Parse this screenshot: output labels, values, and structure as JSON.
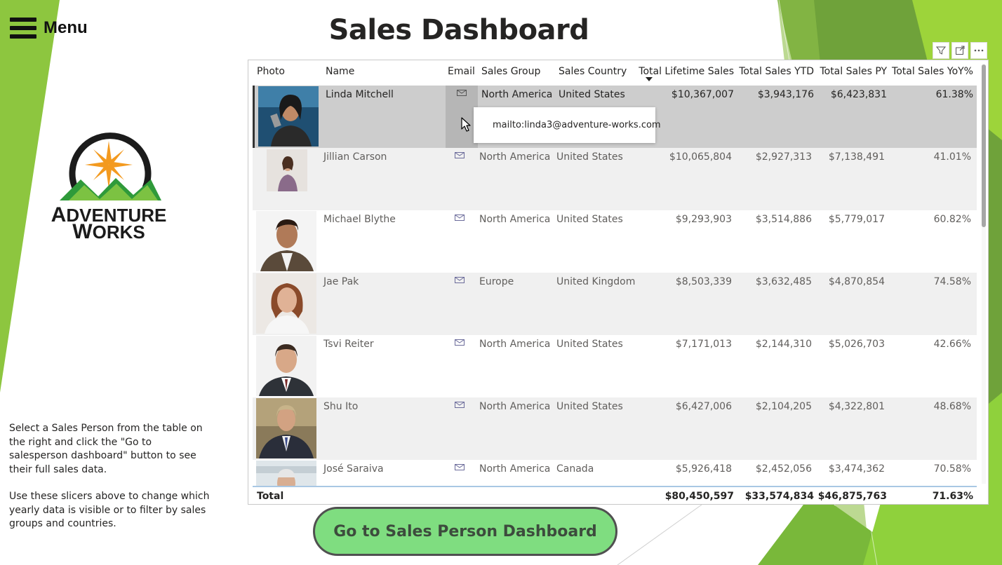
{
  "header": {
    "menu_label": "Menu",
    "title": "Sales Dashboard"
  },
  "logo": {
    "line1_first": "A",
    "line1_rest": "DVENTURE",
    "line2_first": "W",
    "line2_rest": "ORKS"
  },
  "instructions": {
    "paragraph1": "Select a Sales Person from the table on the right and click the \"Go to salesperson dashboard\" button to see their full sales data.",
    "paragraph2": "Use these slicers above to change which yearly data is visible or to filter by sales groups and countries."
  },
  "visual_header": {
    "icons": [
      "filter-icon",
      "focus-mode-icon",
      "more-options-icon"
    ]
  },
  "table": {
    "columns": {
      "photo": "Photo",
      "name": "Name",
      "email": "Email",
      "sales_group": "Sales Group",
      "sales_country": "Sales Country",
      "lifetime": "Total Lifetime Sales",
      "ytd": "Total Sales YTD",
      "py": "Total Sales PY",
      "yoy": "Total Sales YoY%"
    },
    "sorted_column": "Total Lifetime Sales",
    "sort_direction": "descending",
    "rows": [
      {
        "name": "Linda Mitchell",
        "group": "North America",
        "country": "United States",
        "lifetime": "$10,367,007",
        "ytd": "$3,943,176",
        "py": "$6,423,831",
        "yoy": "61.38%"
      },
      {
        "name": "Jillian Carson",
        "group": "North America",
        "country": "United States",
        "lifetime": "$10,065,804",
        "ytd": "$2,927,313",
        "py": "$7,138,491",
        "yoy": "41.01%"
      },
      {
        "name": "Michael Blythe",
        "group": "North America",
        "country": "United States",
        "lifetime": "$9,293,903",
        "ytd": "$3,514,886",
        "py": "$5,779,017",
        "yoy": "60.82%"
      },
      {
        "name": "Jae Pak",
        "group": "Europe",
        "country": "United Kingdom",
        "lifetime": "$8,503,339",
        "ytd": "$3,632,485",
        "py": "$4,870,854",
        "yoy": "74.58%"
      },
      {
        "name": "Tsvi Reiter",
        "group": "North America",
        "country": "United States",
        "lifetime": "$7,171,013",
        "ytd": "$2,144,310",
        "py": "$5,026,703",
        "yoy": "42.66%"
      },
      {
        "name": "Shu Ito",
        "group": "North America",
        "country": "United States",
        "lifetime": "$6,427,006",
        "ytd": "$2,104,205",
        "py": "$4,322,801",
        "yoy": "48.68%"
      },
      {
        "name": "José Saraiva",
        "group": "North America",
        "country": "Canada",
        "lifetime": "$5,926,418",
        "ytd": "$2,452,056",
        "py": "$3,474,362",
        "yoy": "70.58%"
      }
    ],
    "total": {
      "label": "Total",
      "lifetime": "$80,450,597",
      "ytd": "$33,574,834",
      "py": "$46,875,763",
      "yoy": "71.63%"
    },
    "selected_row": "Linda Mitchell",
    "scroll_position": 0
  },
  "tooltip": {
    "text": "mailto:linda3@adventure-works.com"
  },
  "action_button": {
    "label": "Go to Sales Person Dashboard"
  },
  "colors": {
    "accent_green": "#7fdd80",
    "background_green_light": "#9dc93e",
    "background_green_dark": "#6fa23a",
    "selected_row": "#cdcdcd",
    "header_rule": "#a9c8e4"
  }
}
